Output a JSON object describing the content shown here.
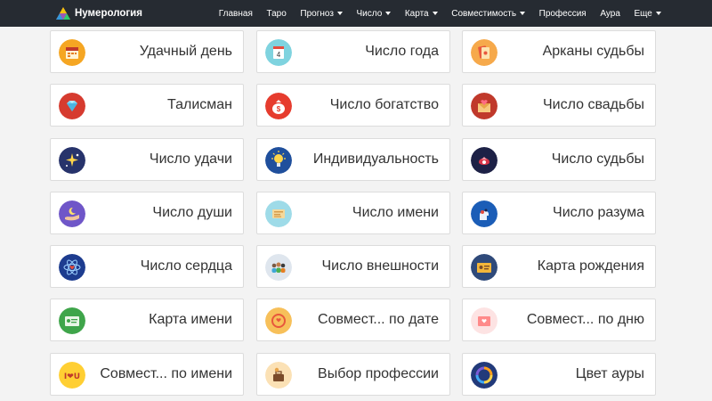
{
  "header": {
    "brand": "Нумерология",
    "nav": [
      {
        "label": "Главная"
      },
      {
        "label": "Таро"
      },
      {
        "label": "Прогноз"
      },
      {
        "label": "Число"
      },
      {
        "label": "Карта"
      },
      {
        "label": "Совместимость"
      },
      {
        "label": "Профессия"
      },
      {
        "label": "Аура"
      },
      {
        "label": "Еще"
      }
    ]
  },
  "cards": [
    {
      "label": "Удачный день",
      "icon": "calendar-day-icon"
    },
    {
      "label": "Число года",
      "icon": "calendar-page-icon",
      "icon_text": "4"
    },
    {
      "label": "Арканы судьбы",
      "icon": "tarot-cards-icon"
    },
    {
      "label": "Талисман",
      "icon": "diamond-icon"
    },
    {
      "label": "Число богатство",
      "icon": "money-bag-icon",
      "icon_text": "$"
    },
    {
      "label": "Число свадьбы",
      "icon": "wedding-envelope-icon"
    },
    {
      "label": "Число удачи",
      "icon": "sparkles-icon"
    },
    {
      "label": "Индивидуальность",
      "icon": "lightbulb-icon"
    },
    {
      "label": "Число судьбы",
      "icon": "fate-icon"
    },
    {
      "label": "Число души",
      "icon": "hand-moon-icon"
    },
    {
      "label": "Число имени",
      "icon": "name-card-icon"
    },
    {
      "label": "Число разума",
      "icon": "mind-icon"
    },
    {
      "label": "Число сердца",
      "icon": "atom-heart-icon"
    },
    {
      "label": "Число внешности",
      "icon": "people-icon"
    },
    {
      "label": "Карта рождения",
      "icon": "id-card-icon"
    },
    {
      "label": "Карта имени",
      "icon": "name-map-icon"
    },
    {
      "label": "Совмест... по дате",
      "icon": "couple-date-icon"
    },
    {
      "label": "Совмест... по дню",
      "icon": "heart-card-icon"
    },
    {
      "label": "Совмест... по имени",
      "icon": "i-love-u-icon",
      "icon_text": "I❤U"
    },
    {
      "label": "Выбор профессии",
      "icon": "profession-icon"
    },
    {
      "label": "Цвет ауры",
      "icon": "aura-ring-icon"
    }
  ]
}
